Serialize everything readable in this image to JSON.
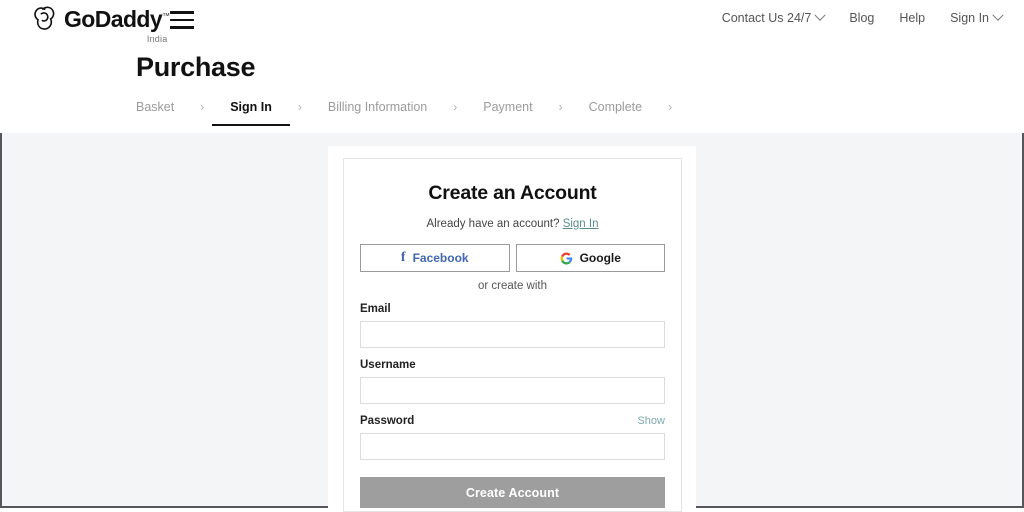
{
  "header": {
    "brand_name": "GoDaddy",
    "brand_tm": "™",
    "brand_locale": "India",
    "menu_icon": "hamburger-menu-icon",
    "nav": [
      {
        "label": "Contact Us 24/7",
        "has_caret": true
      },
      {
        "label": "Blog",
        "has_caret": false
      },
      {
        "label": "Help",
        "has_caret": false
      },
      {
        "label": "Sign In",
        "has_caret": true
      }
    ]
  },
  "page": {
    "title": "Purchase"
  },
  "steps": [
    {
      "label": "Basket",
      "active": false
    },
    {
      "label": "Sign In",
      "active": true
    },
    {
      "label": "Billing Information",
      "active": false
    },
    {
      "label": "Payment",
      "active": false
    },
    {
      "label": "Complete",
      "active": false
    }
  ],
  "step_separator": "›",
  "card": {
    "title": "Create an Account",
    "have_account_text": "Already have an account?",
    "sign_in_link": "Sign In",
    "social": {
      "facebook_label": "Facebook",
      "facebook_glyph": "f",
      "google_label": "Google",
      "google_glyph": "G"
    },
    "divider_text": "or create with",
    "fields": [
      {
        "label": "Email",
        "value": "",
        "placeholder": "",
        "action": ""
      },
      {
        "label": "Username",
        "value": "",
        "placeholder": "",
        "action": ""
      },
      {
        "label": "Password",
        "value": "",
        "placeholder": "",
        "action": "Show"
      }
    ],
    "submit_label": "Create Account"
  },
  "colors": {
    "accent_link": "#5a8c8c",
    "facebook_blue": "#4267b2",
    "body_background": "#f4f5f7",
    "submit_disabled": "#9e9e9e",
    "active_step": "#111111"
  }
}
